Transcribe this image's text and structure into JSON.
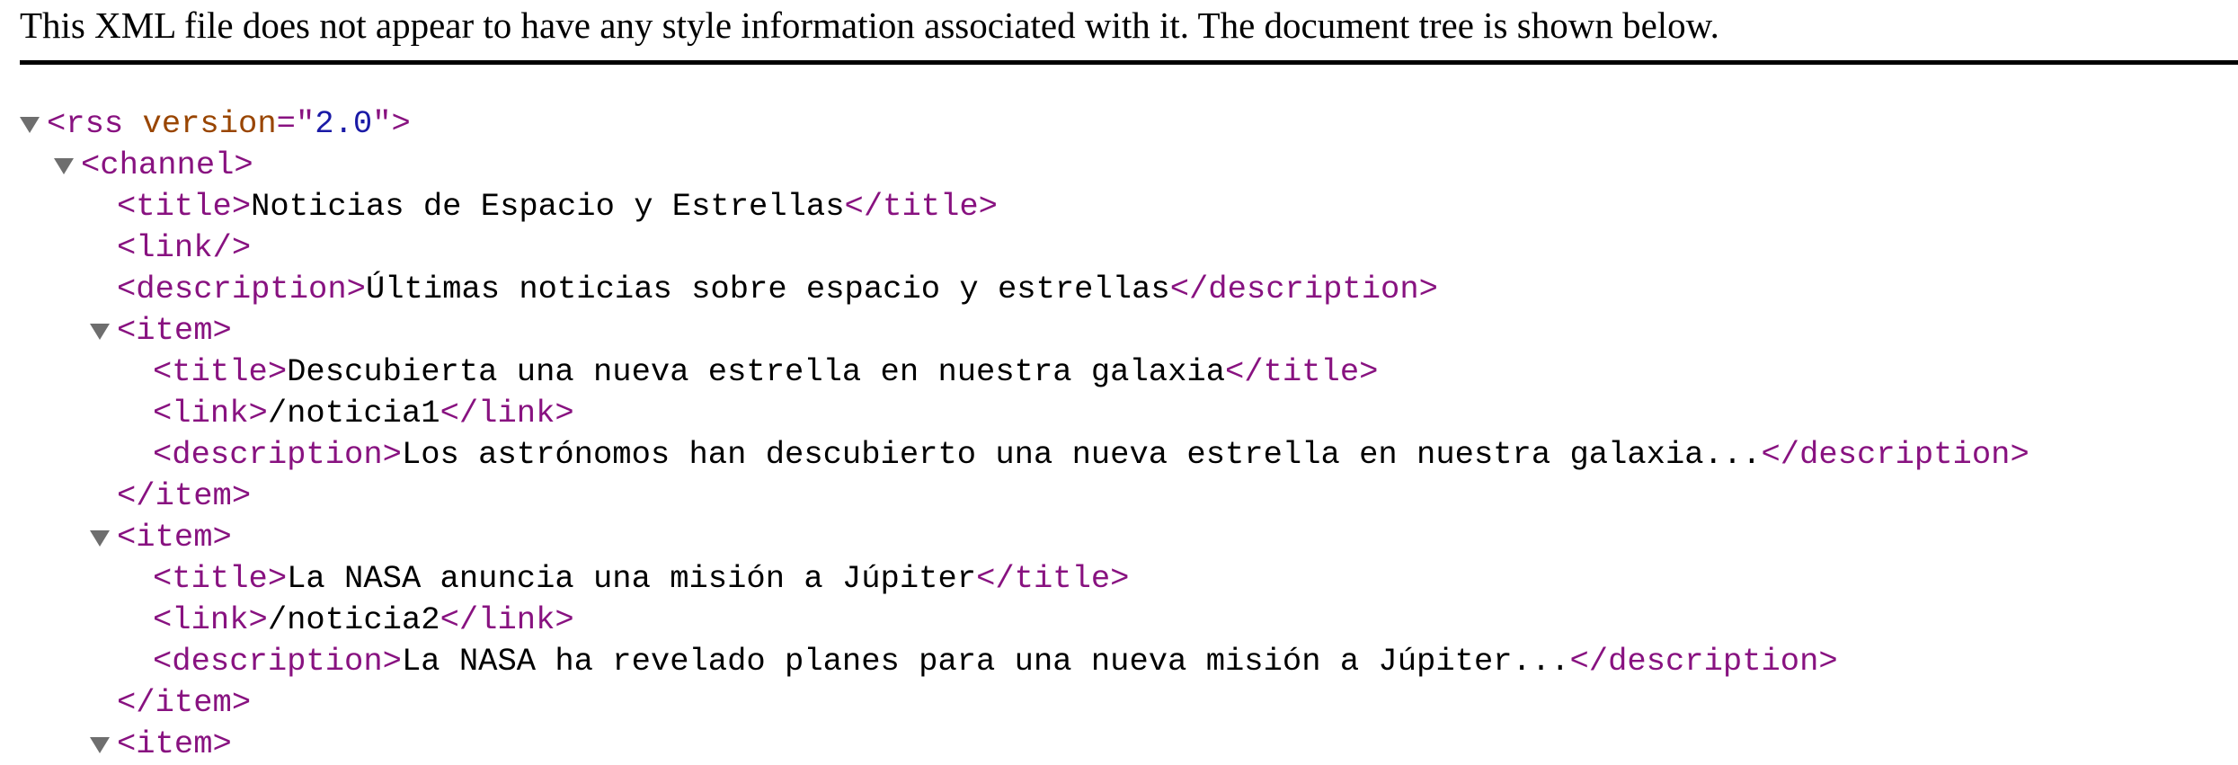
{
  "header": {
    "message": "This XML file does not appear to have any style information associated with it. The document tree is shown below."
  },
  "tree": {
    "rss_open": "<rss",
    "rss_attr_name": " version",
    "rss_eq": "=\"",
    "rss_attr_value": "2.0",
    "rss_close_quote": "\">",
    "channel_open": "<channel>",
    "channel_title_open": "<title>",
    "channel_title_text": "Noticias de Espacio y Estrellas",
    "channel_title_close": "</title>",
    "channel_link": "<link/>",
    "channel_desc_open": "<description>",
    "channel_desc_text": "Últimas noticias sobre espacio y estrellas",
    "channel_desc_close": "</description>",
    "item_open": "<item>",
    "item_close": "</item>",
    "title_open": "<title>",
    "title_close": "</title>",
    "link_open": "<link>",
    "link_close": "</link>",
    "desc_open": "<description>",
    "desc_close": "</description>",
    "items": [
      {
        "title": "Descubierta una nueva estrella en nuestra galaxia",
        "link": "/noticia1",
        "description": "Los astrónomos han descubierto una nueva estrella en nuestra galaxia..."
      },
      {
        "title": "La NASA anuncia una misión a Júpiter",
        "link": "/noticia2",
        "description": "La NASA ha revelado planes para una nueva misión a Júpiter..."
      }
    ],
    "item3_partial": "<item>"
  },
  "colors": {
    "tag": "#881280",
    "attribute_name": "#994500",
    "attribute_value": "#1a1aa6",
    "text": "#000000",
    "triangle": "#6e6e6e"
  },
  "icons": {
    "expand_toggle": "disclosure-triangle-icon"
  }
}
